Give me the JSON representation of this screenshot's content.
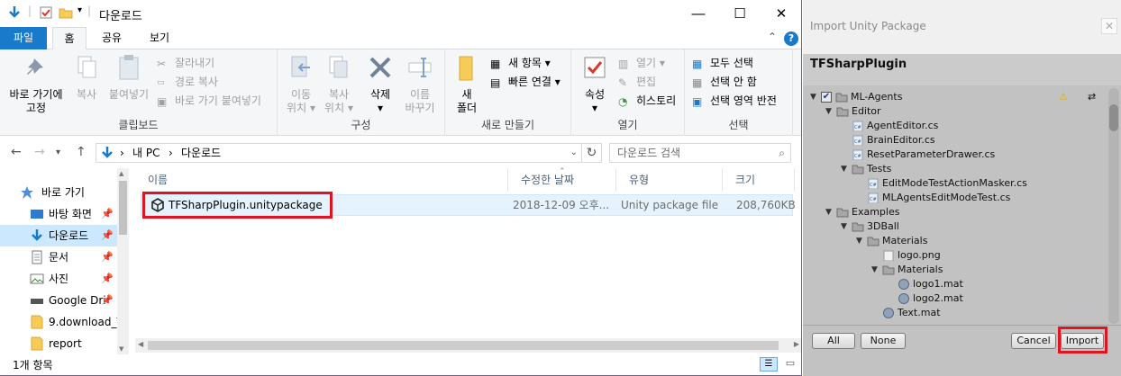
{
  "explorer": {
    "title": "다운로드",
    "tabs": {
      "file": "파일",
      "home": "홈",
      "share": "공유",
      "view": "보기"
    },
    "ribbon": {
      "clipboard": {
        "label": "클립보드",
        "pin": "바로 가기에\n고정",
        "pin_l1": "바로 가기에",
        "pin_l2": "고정",
        "copy": "복사",
        "paste": "붙여넣기",
        "cut": "잘라내기",
        "copy_path": "경로 복사",
        "paste_shortcut": "바로 가기 붙여넣기"
      },
      "organize": {
        "label": "구성",
        "move_l1": "이동",
        "move_l2": "위치",
        "copy_l1": "복사",
        "copy_l2": "위치",
        "delete": "삭제",
        "rename_l1": "이름",
        "rename_l2": "바꾸기"
      },
      "new": {
        "label": "새로 만들기",
        "folder_l1": "새",
        "folder_l2": "폴더",
        "new_item": "새 항목",
        "easy_access": "빠른 연결"
      },
      "open": {
        "label": "열기",
        "properties": "속성",
        "open": "열기",
        "edit": "편집",
        "history": "히스토리"
      },
      "select": {
        "label": "선택",
        "select_all": "모두 선택",
        "select_none": "선택 안 함",
        "invert": "선택 영역 반전"
      }
    },
    "address": {
      "pc": "내 PC",
      "folder": "다운로드"
    },
    "search_placeholder": "다운로드 검색",
    "nav": [
      {
        "label": "바로 가기",
        "icon": "star-icon",
        "pinned": false
      },
      {
        "label": "바탕 화면",
        "icon": "desktop-icon",
        "pinned": true
      },
      {
        "label": "다운로드",
        "icon": "download-icon",
        "pinned": true
      },
      {
        "label": "문서",
        "icon": "document-icon",
        "pinned": true
      },
      {
        "label": "사진",
        "icon": "picture-icon",
        "pinned": true
      },
      {
        "label": "Google Dri",
        "icon": "drive-icon",
        "pinned": true
      },
      {
        "label": "9.download_T",
        "icon": "folder-icon",
        "pinned": false
      },
      {
        "label": "report",
        "icon": "folder-icon",
        "pinned": false
      }
    ],
    "columns": {
      "name": "이름",
      "modified": "수정한 날짜",
      "type": "유형",
      "size": "크기"
    },
    "files": [
      {
        "name": "TFSharpPlugin.unitypackage",
        "modified": "2018-12-09 오후...",
        "type": "Unity package file",
        "size": "208,760KB"
      }
    ],
    "status": "1개 항목"
  },
  "unity": {
    "window_title": "Import Unity Package",
    "package_name": "TFSharpPlugin",
    "tree": [
      {
        "label": "ML-Agents",
        "type": "folder",
        "expanded": true,
        "checkbox": true
      },
      {
        "label": "Editor",
        "type": "folder",
        "expanded": true
      },
      {
        "label": "AgentEditor.cs",
        "type": "cs"
      },
      {
        "label": "BrainEditor.cs",
        "type": "cs"
      },
      {
        "label": "ResetParameterDrawer.cs",
        "type": "cs"
      },
      {
        "label": "Tests",
        "type": "folder",
        "expanded": true
      },
      {
        "label": "EditModeTestActionMasker.cs",
        "type": "cs"
      },
      {
        "label": "MLAgentsEditModeTest.cs",
        "type": "cs"
      },
      {
        "label": "Examples",
        "type": "folder",
        "expanded": true
      },
      {
        "label": "3DBall",
        "type": "folder",
        "expanded": true
      },
      {
        "label": "Materials",
        "type": "folder",
        "expanded": true
      },
      {
        "label": "logo.png",
        "type": "png"
      },
      {
        "label": "Materials",
        "type": "folder",
        "expanded": true
      },
      {
        "label": "logo1.mat",
        "type": "mat"
      },
      {
        "label": "logo2.mat",
        "type": "mat"
      },
      {
        "label": "Text.mat",
        "type": "mat"
      }
    ],
    "buttons": {
      "all": "All",
      "none": "None",
      "cancel": "Cancel",
      "import": "Import"
    },
    "colors": {
      "highlight": "#e0141e",
      "accent": "#1979ca"
    }
  }
}
